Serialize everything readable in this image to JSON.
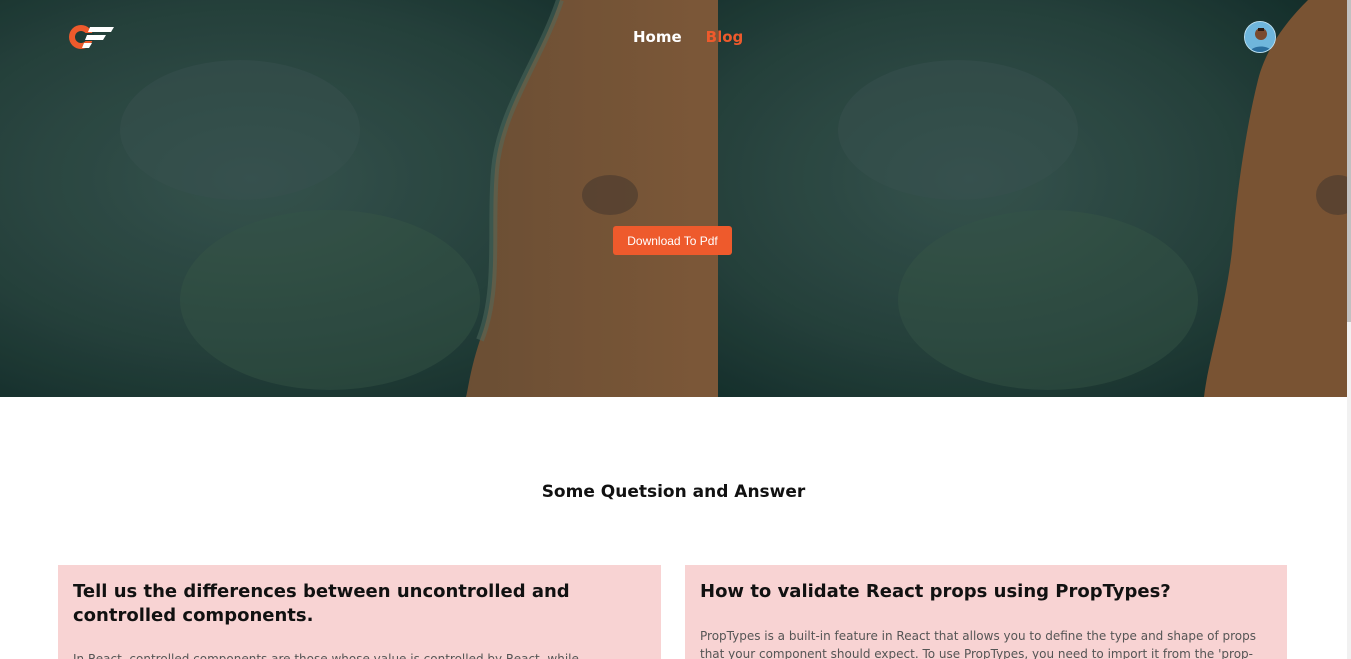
{
  "header": {
    "logo_icon": "cf-logo-icon",
    "nav": [
      {
        "label": "Home",
        "active": false
      },
      {
        "label": "Blog",
        "active": true
      }
    ],
    "avatar_icon": "user-avatar-icon"
  },
  "hero": {
    "download_label": "Download To Pdf"
  },
  "section": {
    "title": "Some Quetsion and Answer"
  },
  "questions": [
    {
      "title": "Tell us the differences between uncontrolled and controlled components.",
      "answer": "In React, controlled components are those whose value is controlled by React, while"
    },
    {
      "title": "How to validate React props using PropTypes?",
      "answer": "PropTypes is a built-in feature in React that allows you to define the type and shape of props that your component should expect. To use PropTypes, you need to import it from the 'prop-"
    }
  ],
  "colors": {
    "accent": "#ee5a2c",
    "card_bg": "#f8d3d3",
    "water": "#2e4f48",
    "sand": "#8a5f38"
  }
}
